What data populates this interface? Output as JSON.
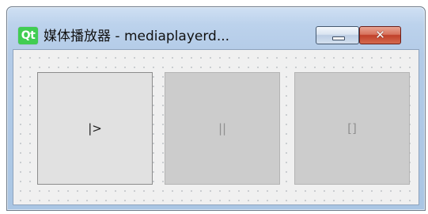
{
  "window": {
    "logo_text": "Qt",
    "title": "媒体播放器 - mediaplayerd...",
    "minimize_label": "",
    "close_label": "✕"
  },
  "controls": {
    "play_label": "|>",
    "pause_label": "||",
    "stop_label": "[]",
    "play_enabled": true,
    "pause_enabled": false,
    "stop_enabled": false
  },
  "icons": {
    "app": "qt-logo-icon",
    "minimize": "minimize-icon",
    "close": "close-icon"
  },
  "colors": {
    "qt_green": "#41cd52",
    "close_red": "#c0402a",
    "titlebar_blue": "#bcd2ec",
    "client_bg": "#f0f0f0"
  }
}
